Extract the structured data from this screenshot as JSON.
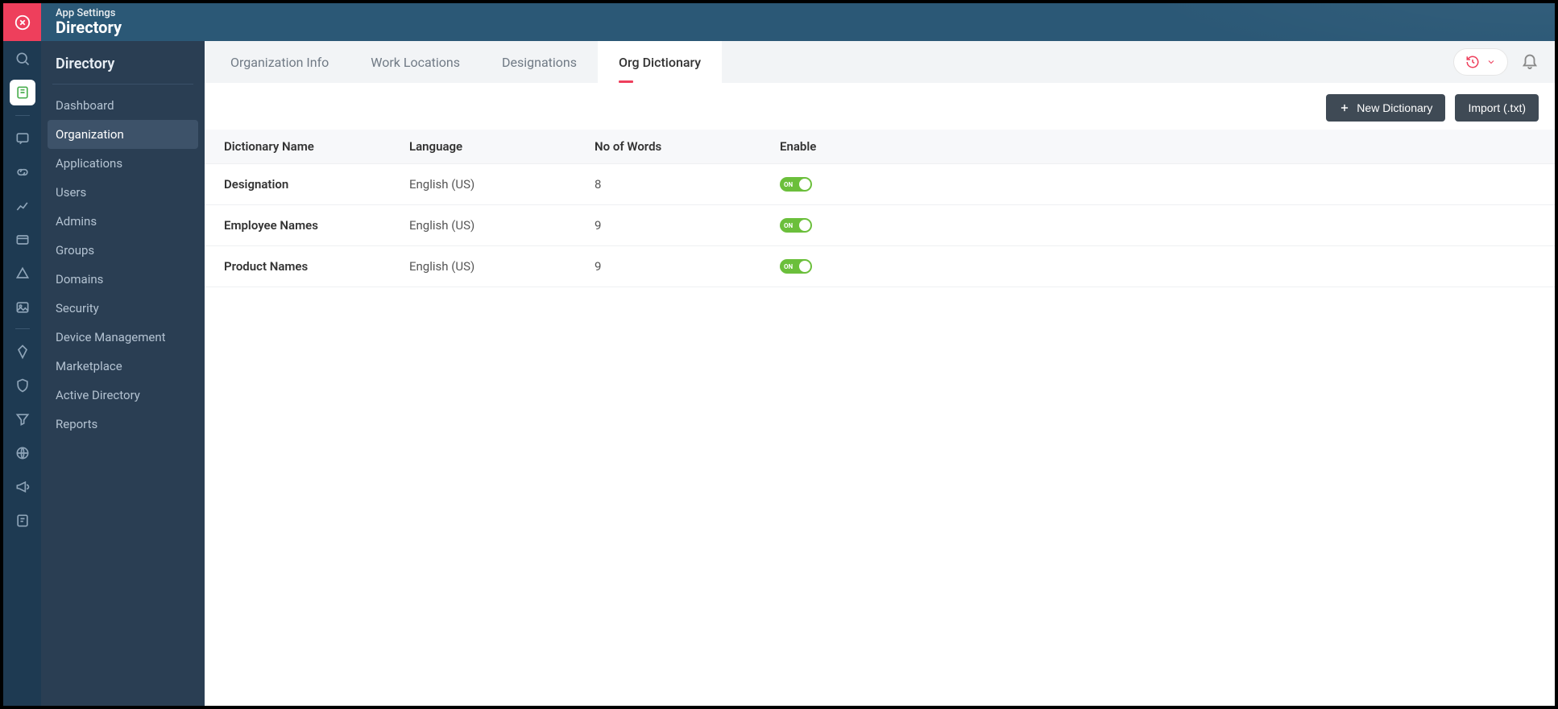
{
  "header": {
    "breadcrumb": "App Settings",
    "title": "Directory"
  },
  "sidebar": {
    "title": "Directory",
    "items": [
      {
        "label": "Dashboard"
      },
      {
        "label": "Organization"
      },
      {
        "label": "Applications"
      },
      {
        "label": "Users"
      },
      {
        "label": "Admins"
      },
      {
        "label": "Groups"
      },
      {
        "label": "Domains"
      },
      {
        "label": "Security"
      },
      {
        "label": "Device Management"
      },
      {
        "label": "Marketplace"
      },
      {
        "label": "Active Directory"
      },
      {
        "label": "Reports"
      }
    ],
    "activeIndex": 1
  },
  "tabs": {
    "items": [
      {
        "label": "Organization Info"
      },
      {
        "label": "Work Locations"
      },
      {
        "label": "Designations"
      },
      {
        "label": "Org Dictionary"
      }
    ],
    "activeIndex": 3
  },
  "actions": {
    "newDictionary": "New Dictionary",
    "importTxt": "Import (.txt)"
  },
  "table": {
    "headers": {
      "name": "Dictionary Name",
      "language": "Language",
      "words": "No of Words",
      "enable": "Enable"
    },
    "rows": [
      {
        "name": "Designation",
        "language": "English (US)",
        "words": "8",
        "enabled": true,
        "toggleLabel": "ON"
      },
      {
        "name": "Employee Names",
        "language": "English (US)",
        "words": "9",
        "enabled": true,
        "toggleLabel": "ON"
      },
      {
        "name": "Product Names",
        "language": "English (US)",
        "words": "9",
        "enabled": true,
        "toggleLabel": "ON"
      }
    ]
  }
}
